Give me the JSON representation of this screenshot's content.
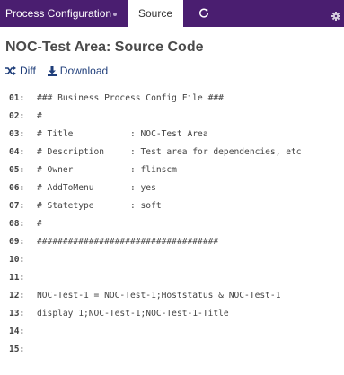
{
  "nav": {
    "config_tab": "Process Configuration",
    "source_tab": "Source",
    "refresh_icon": "refresh-icon",
    "settings_icon": "gear-icon"
  },
  "page": {
    "title": "NOC-Test Area: Source Code"
  },
  "actions": {
    "diff_label": "Diff",
    "download_label": "Download"
  },
  "code": {
    "lines": [
      {
        "num": "01:",
        "text": "### Business Process Config File ###"
      },
      {
        "num": "02:",
        "text": "#"
      },
      {
        "num": "03:",
        "text": "# Title           : NOC-Test Area"
      },
      {
        "num": "04:",
        "text": "# Description     : Test area for dependencies, etc"
      },
      {
        "num": "05:",
        "text": "# Owner           : flinscm"
      },
      {
        "num": "06:",
        "text": "# AddToMenu       : yes"
      },
      {
        "num": "07:",
        "text": "# Statetype       : soft"
      },
      {
        "num": "08:",
        "text": "#"
      },
      {
        "num": "09:",
        "text": "###################################"
      },
      {
        "num": "10:",
        "text": ""
      },
      {
        "num": "11:",
        "text": ""
      },
      {
        "num": "12:",
        "text": "NOC-Test-1 = NOC-Test-1;Hoststatus & NOC-Test-1"
      },
      {
        "num": "13:",
        "text": "display 1;NOC-Test-1;NOC-Test-1-Title"
      },
      {
        "num": "14:",
        "text": ""
      },
      {
        "num": "15:",
        "text": ""
      }
    ]
  },
  "colors": {
    "nav_bg": "#4a1e70",
    "link": "#1f3e7a"
  }
}
